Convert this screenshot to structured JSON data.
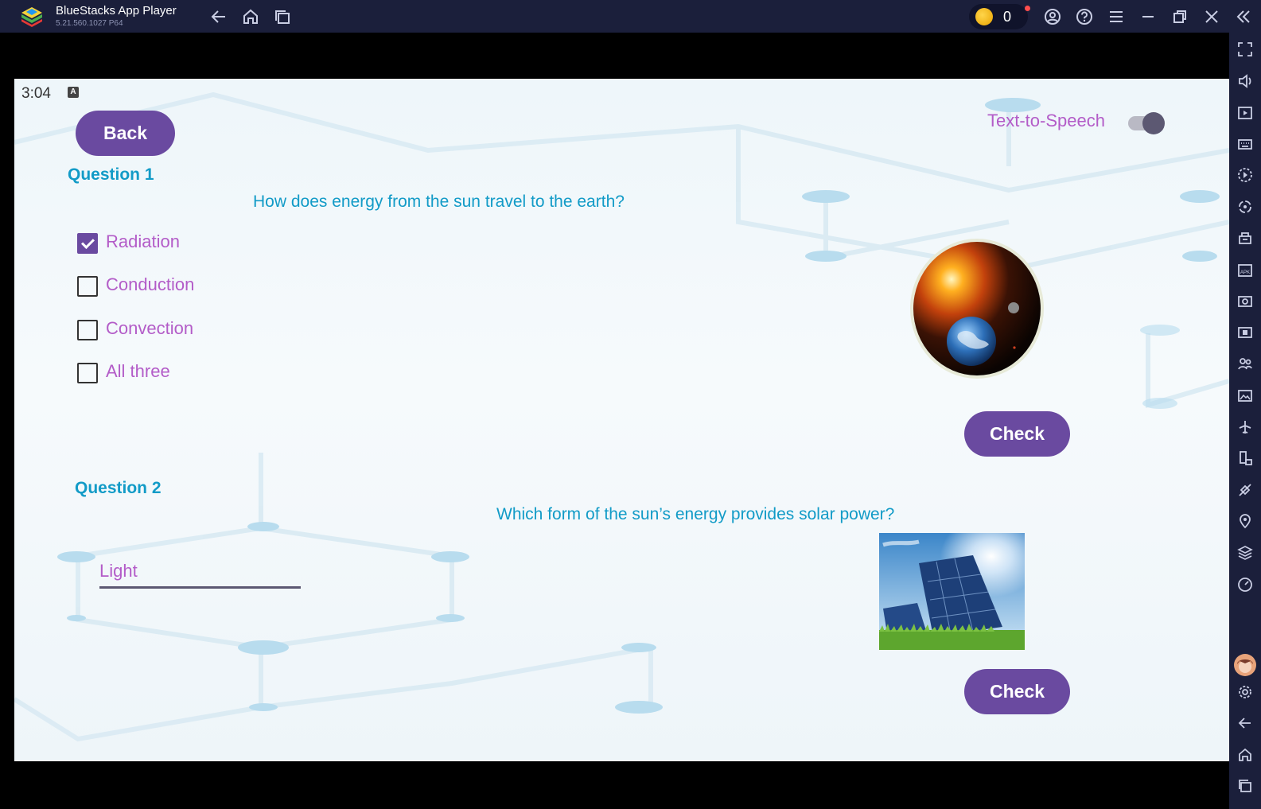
{
  "window": {
    "app_name": "BlueStacks App Player",
    "app_version": "5.21.560.1027  P64",
    "coin_count": "0"
  },
  "status_bar": {
    "time": "3:04",
    "indicator": "A"
  },
  "screen": {
    "back_label": "Back",
    "tts_label": "Text-to-Speech",
    "tts_enabled": false,
    "question1": {
      "heading": "Question 1",
      "text": "How does energy from the sun travel to the earth?",
      "options": [
        {
          "label": "Radiation",
          "checked": true
        },
        {
          "label": "Conduction",
          "checked": false
        },
        {
          "label": "Convection",
          "checked": false
        },
        {
          "label": "All three",
          "checked": false
        }
      ],
      "image_icon": "sun-earth-image",
      "check_label": "Check"
    },
    "question2": {
      "heading": "Question 2",
      "text": "Which form of the sun’s energy provides solar power?",
      "answer_value": "Light",
      "image_icon": "solar-panel-image",
      "check_label": "Check"
    }
  },
  "colors": {
    "accent_purple": "#6a4aa0",
    "option_text": "#b35cc8",
    "question_blue": "#129bc7",
    "chrome_bg": "#1b1f3b"
  }
}
